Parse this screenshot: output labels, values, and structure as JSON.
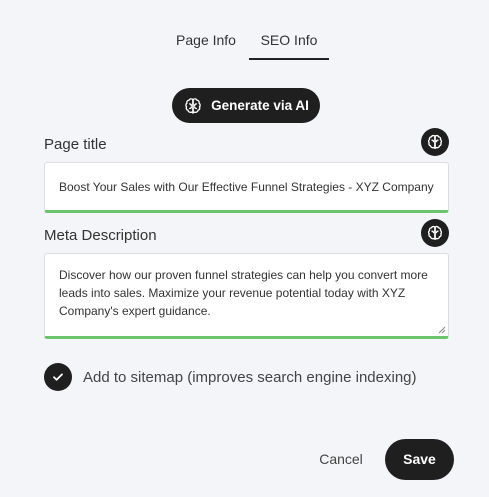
{
  "tabs": [
    {
      "label": "Page Info",
      "active": false
    },
    {
      "label": "SEO Info",
      "active": true
    }
  ],
  "ai_button": {
    "label": "Generate via AI",
    "icon": "brain-icon"
  },
  "page_title": {
    "label": "Page title",
    "value": "Boost Your Sales with Our Effective Funnel Strategies - XYZ Company",
    "ai_icon": "brain-icon"
  },
  "meta_description": {
    "label": "Meta Description",
    "value": "Discover how our proven funnel strategies can help you convert more leads into sales. Maximize your revenue potential today with XYZ Company's expert guidance.",
    "ai_icon": "brain-icon"
  },
  "sitemap": {
    "label": "Add to sitemap (improves search engine indexing)",
    "checked": true
  },
  "footer": {
    "cancel_label": "Cancel",
    "save_label": "Save"
  },
  "colors": {
    "accent_dark": "#1f1f1f",
    "valid_underline": "#6cc56c",
    "background": "#f4f5f9"
  }
}
